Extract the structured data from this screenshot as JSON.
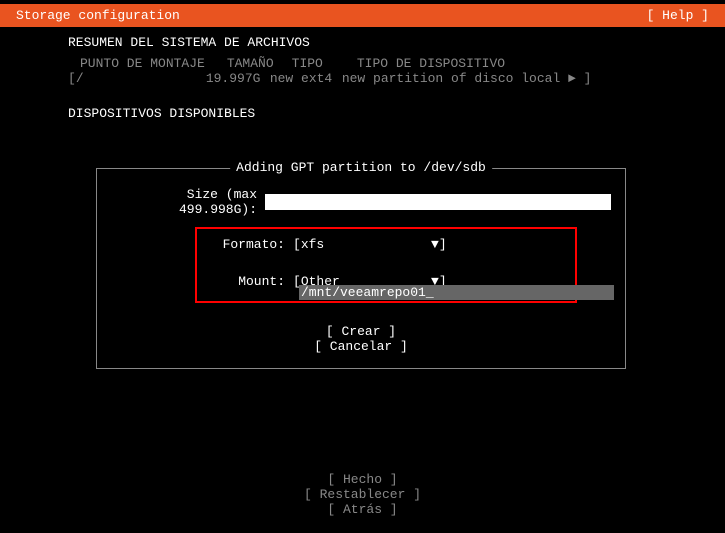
{
  "header": {
    "title": "Storage configuration",
    "help": "[ Help ]"
  },
  "summary": {
    "title": "RESUMEN DEL SISTEMA DE ARCHIVOS",
    "columns": {
      "mount": "PUNTO DE MONTAJE",
      "size": "TAMAÑO",
      "type": "TIPO",
      "devtype": "TIPO DE DISPOSITIVO"
    },
    "rows": [
      {
        "mount_b_open": "[",
        "mount": " /",
        "size": "19.997G",
        "type": "new ext4",
        "devtype": "new partition of disco local ► ",
        "mount_b_close": "]"
      }
    ]
  },
  "devices": {
    "title": "DISPOSITIVOS DISPONIBLES"
  },
  "dialog": {
    "title": " Adding GPT partition to /dev/sdb ",
    "size_label": "Size (max 499.998G):",
    "format_label": "Formato:",
    "format_open": "[ ",
    "format_value": "xfs",
    "format_arrow": "▼",
    "format_close": " ]",
    "mount_label": "Mount:",
    "mount_open": "[ ",
    "mount_value": "Other",
    "mount_arrow": "▼",
    "mount_close": " ]",
    "mount_input": "/mnt/veeamrepo01_",
    "create_btn": "[ Crear      ]",
    "cancel_btn": "[ Cancelar   ]"
  },
  "footer": {
    "done": "[ Hecho        ]",
    "reset": "[ Restablecer  ]",
    "back": "[ Atrás        ]"
  }
}
